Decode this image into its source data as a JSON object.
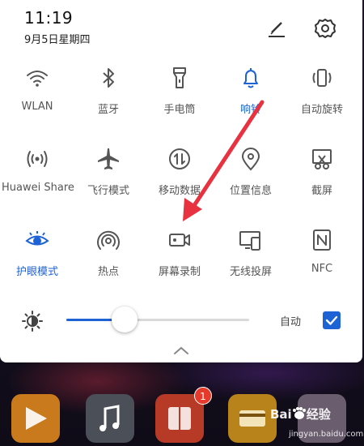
{
  "status": {
    "time": "11:19",
    "date": "9月5日星期四"
  },
  "header_icons": {
    "edit": "edit-pencil-icon",
    "settings": "gear-icon"
  },
  "toggles": [
    {
      "label": "WLAN",
      "icon": "wifi-icon",
      "active": false
    },
    {
      "label": "蓝牙",
      "icon": "bluetooth-icon",
      "active": false
    },
    {
      "label": "手电筒",
      "icon": "flashlight-icon",
      "active": false
    },
    {
      "label": "响铃",
      "icon": "bell-icon",
      "active": true
    },
    {
      "label": "自动旋转",
      "icon": "rotate-icon",
      "active": false
    },
    {
      "label": "Huawei Share",
      "icon": "share-icon",
      "active": false
    },
    {
      "label": "飞行模式",
      "icon": "airplane-icon",
      "active": false
    },
    {
      "label": "移动数据",
      "icon": "mobile-data-icon",
      "active": false
    },
    {
      "label": "位置信息",
      "icon": "location-icon",
      "active": false
    },
    {
      "label": "截屏",
      "icon": "screenshot-icon",
      "active": false
    },
    {
      "label": "护眼模式",
      "icon": "eye-icon",
      "active": true
    },
    {
      "label": "热点",
      "icon": "hotspot-icon",
      "active": false
    },
    {
      "label": "屏幕录制",
      "icon": "screen-record-icon",
      "active": false
    },
    {
      "label": "无线投屏",
      "icon": "wireless-projection-icon",
      "active": false
    },
    {
      "label": "NFC",
      "icon": "nfc-icon",
      "active": false
    }
  ],
  "brightness": {
    "level": 0.32,
    "auto_label": "自动",
    "auto_checked": true
  },
  "dock": {
    "badge_count": "1"
  },
  "watermark": {
    "brand": "Bai",
    "suffix": "经验",
    "url": "jingyan.baidu.com"
  },
  "colors": {
    "accent": "#1e63d6",
    "arrow": "#e8323f"
  }
}
